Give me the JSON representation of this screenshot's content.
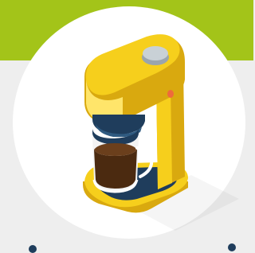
{
  "colors": {
    "top_band": "#a3c419",
    "page_bg": "#eeeeee",
    "circle": "#ffffff",
    "machine_body": "#f6cf1c",
    "machine_dark": "#d9a90f",
    "machine_light": "#ffe56a",
    "base_navy": "#1f3d5c",
    "coffee": "#6b3f1c",
    "coffee_dark": "#4b2a10",
    "button": "#c9d1d6",
    "indicator": "#ee6a3c"
  },
  "icons": {
    "illustration": "coffee-maker-icon",
    "button": "power-button-icon",
    "indicator": "indicator-light-icon"
  }
}
